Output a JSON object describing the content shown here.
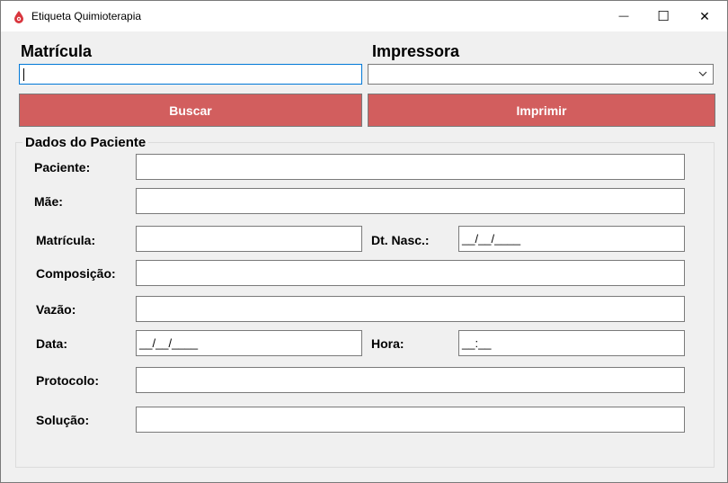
{
  "window": {
    "title": "Etiqueta Quimioterapia",
    "minimize_glyph": "—",
    "maximize_glyph": "☐",
    "close_glyph": "✕"
  },
  "header": {
    "matricula_label": "Matrícula",
    "impressora_label": "Impressora",
    "matricula_value": "",
    "impressora_value": ""
  },
  "buttons": {
    "buscar": "Buscar",
    "imprimir": "Imprimir",
    "color": "#d25e5e"
  },
  "patient": {
    "group_title": "Dados do Paciente",
    "labels": {
      "paciente": "Paciente:",
      "mae": "Mãe:",
      "matricula": "Matrícula:",
      "dt_nasc": "Dt. Nasc.:",
      "composicao": "Composição:",
      "vazao": "Vazão:",
      "data": "Data:",
      "hora": "Hora:",
      "protocolo": "Protocolo:",
      "solucao": "Solução:"
    },
    "values": {
      "paciente": "",
      "mae": "",
      "matricula": "",
      "dt_nasc": "__/__/____",
      "composicao": "",
      "vazao": "",
      "data": "__/__/____",
      "hora": "__:__",
      "protocolo": "",
      "solucao": ""
    }
  }
}
